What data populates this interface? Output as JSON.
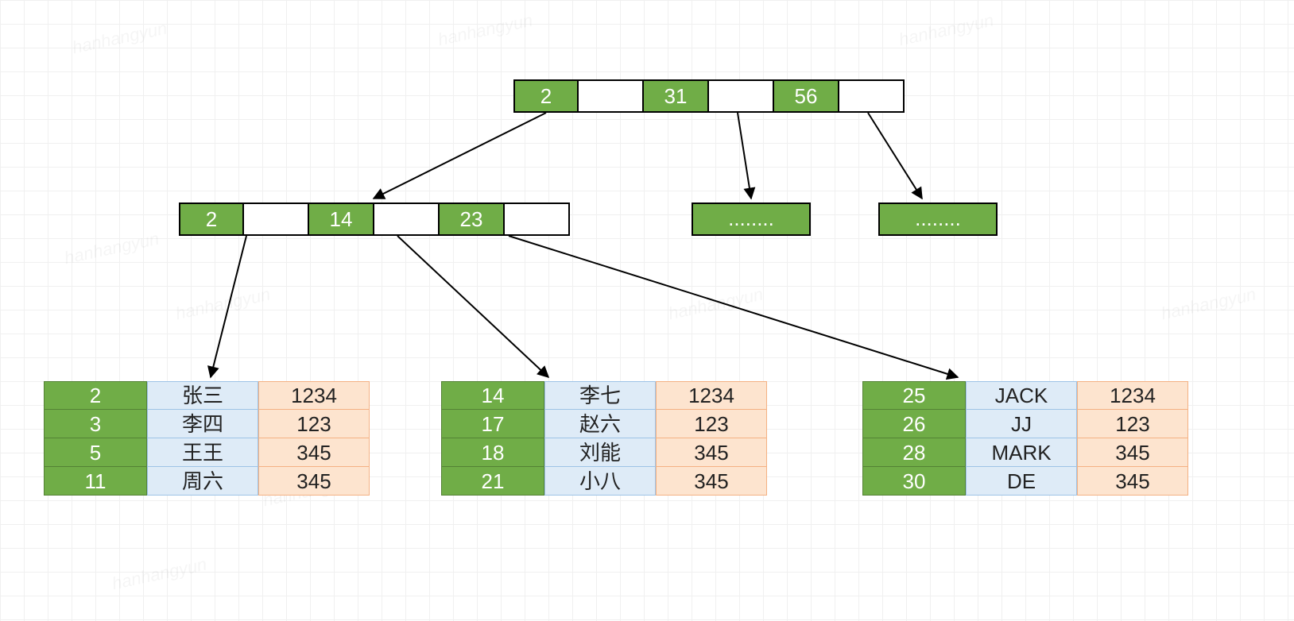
{
  "watermark": "hanhangyun",
  "root": {
    "keys": [
      "2",
      "31",
      "56"
    ]
  },
  "internal": {
    "keys": [
      "2",
      "14",
      "23"
    ]
  },
  "placeholders": [
    "........",
    "........"
  ],
  "leaves": [
    {
      "rows": [
        {
          "id": "2",
          "name": "张三",
          "val": "1234"
        },
        {
          "id": "3",
          "name": "李四",
          "val": "123"
        },
        {
          "id": "5",
          "name": "王王",
          "val": "345"
        },
        {
          "id": "11",
          "name": "周六",
          "val": "345"
        }
      ]
    },
    {
      "rows": [
        {
          "id": "14",
          "name": "李七",
          "val": "1234"
        },
        {
          "id": "17",
          "name": "赵六",
          "val": "123"
        },
        {
          "id": "18",
          "name": "刘能",
          "val": "345"
        },
        {
          "id": "21",
          "name": "小八",
          "val": "345"
        }
      ]
    },
    {
      "rows": [
        {
          "id": "25",
          "name": "JACK",
          "val": "1234"
        },
        {
          "id": "26",
          "name": "JJ",
          "val": "123"
        },
        {
          "id": "28",
          "name": "MARK",
          "val": "345"
        },
        {
          "id": "30",
          "name": "DE",
          "val": "345"
        }
      ]
    }
  ],
  "colors": {
    "green": "#70ad47",
    "blue": "#deebf7",
    "orange": "#fde4cf"
  }
}
